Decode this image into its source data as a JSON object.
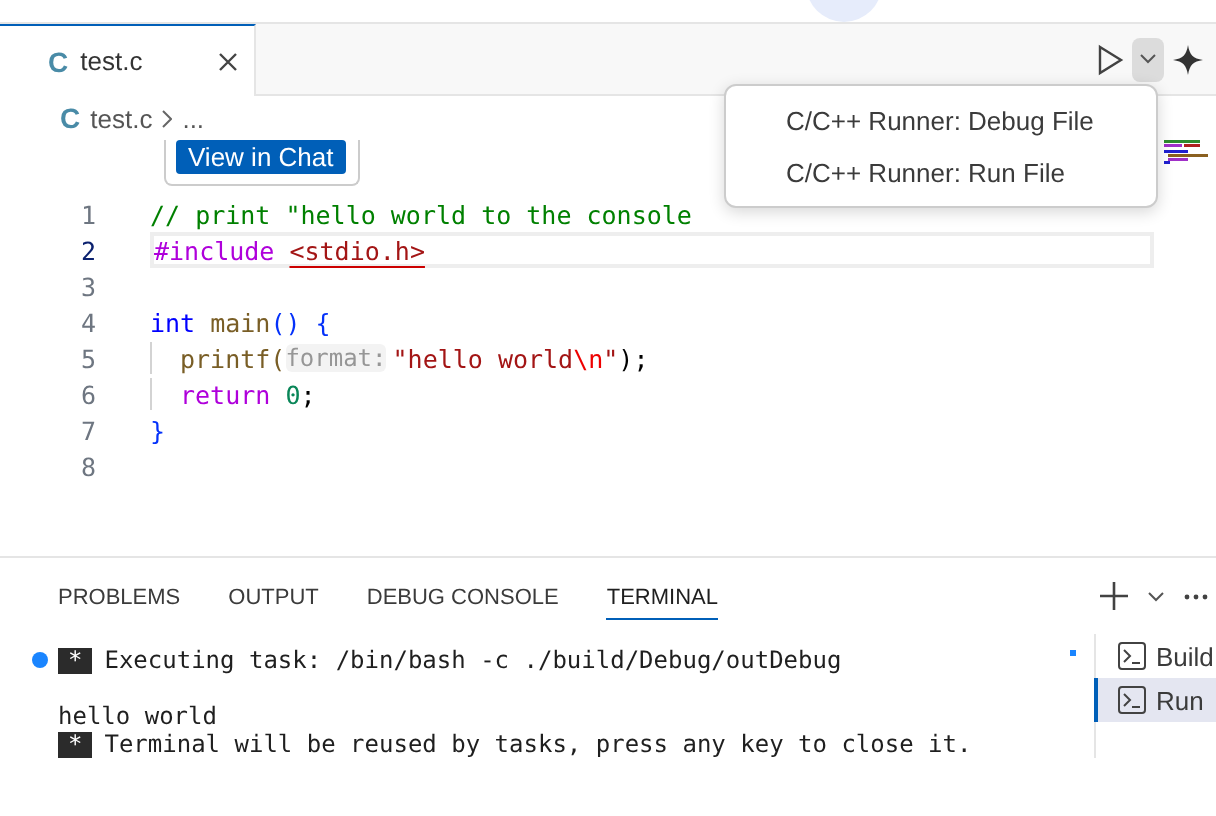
{
  "tabs": [
    {
      "icon": "C",
      "label": "test.c",
      "selected": true
    }
  ],
  "breadcrumb": {
    "icon": "C",
    "file": "test.c",
    "rest": "..."
  },
  "run_menu": {
    "expanded": true,
    "items": [
      {
        "label": "C/C++ Runner: Debug File"
      },
      {
        "label": "C/C++ Runner: Run File"
      }
    ]
  },
  "chat_button": {
    "label": "View in Chat"
  },
  "editor": {
    "lines": [
      {
        "number": "1",
        "current": false,
        "indented": false,
        "tokens": [
          {
            "kind": "comment",
            "text": "// print \"hello world to the console"
          }
        ]
      },
      {
        "number": "2",
        "current": true,
        "indented": false,
        "tokens": [
          {
            "kind": "keyword",
            "text": "#include "
          },
          {
            "kind": "error-path",
            "text": "<stdio.h>"
          }
        ]
      },
      {
        "number": "3",
        "current": false,
        "indented": false
      },
      {
        "number": "4",
        "current": false,
        "indented": false,
        "tokens": [
          {
            "kind": "type",
            "text": "int "
          },
          {
            "kind": "function",
            "text": "main"
          },
          {
            "kind": "bracket",
            "text": "() {"
          }
        ]
      },
      {
        "number": "5",
        "current": false,
        "indented": true,
        "tokens": [
          {
            "kind": "function",
            "text": "printf("
          },
          {
            "kind": "hint",
            "text": "format:"
          },
          {
            "kind": "string",
            "text": "\"hello world"
          },
          {
            "kind": "escape",
            "text": "\\n"
          },
          {
            "kind": "string",
            "text": "\""
          },
          {
            "kind": "plain",
            "text": ");"
          }
        ]
      },
      {
        "number": "6",
        "current": false,
        "indented": true,
        "tokens": [
          {
            "kind": "keyword",
            "text": "return "
          },
          {
            "kind": "number",
            "text": "0"
          },
          {
            "kind": "plain",
            "text": ";"
          }
        ]
      },
      {
        "number": "7",
        "current": false,
        "indented": false,
        "tokens": [
          {
            "kind": "bracket",
            "text": "}"
          }
        ]
      },
      {
        "number": "8",
        "current": false,
        "indented": false
      }
    ]
  },
  "panel": {
    "tabs": [
      {
        "label": "PROBLEMS",
        "selected": false
      },
      {
        "label": "OUTPUT",
        "selected": false
      },
      {
        "label": "DEBUG CONSOLE",
        "selected": false
      },
      {
        "label": "TERMINAL",
        "selected": true
      }
    ],
    "terminal": [
      {
        "kind": "task",
        "decorated": true,
        "marker": "*",
        "text": "Executing task: /bin/bash -c ./build/Debug/outDebug"
      },
      {
        "kind": "output",
        "decorated": false,
        "text": "hello world"
      },
      {
        "kind": "task",
        "decorated": false,
        "marker": "*",
        "text": "Terminal will be reused by tasks, press any key to close it."
      }
    ],
    "terminals": [
      {
        "label": "Build",
        "selected": false
      },
      {
        "label": "Run",
        "selected": true
      }
    ]
  }
}
